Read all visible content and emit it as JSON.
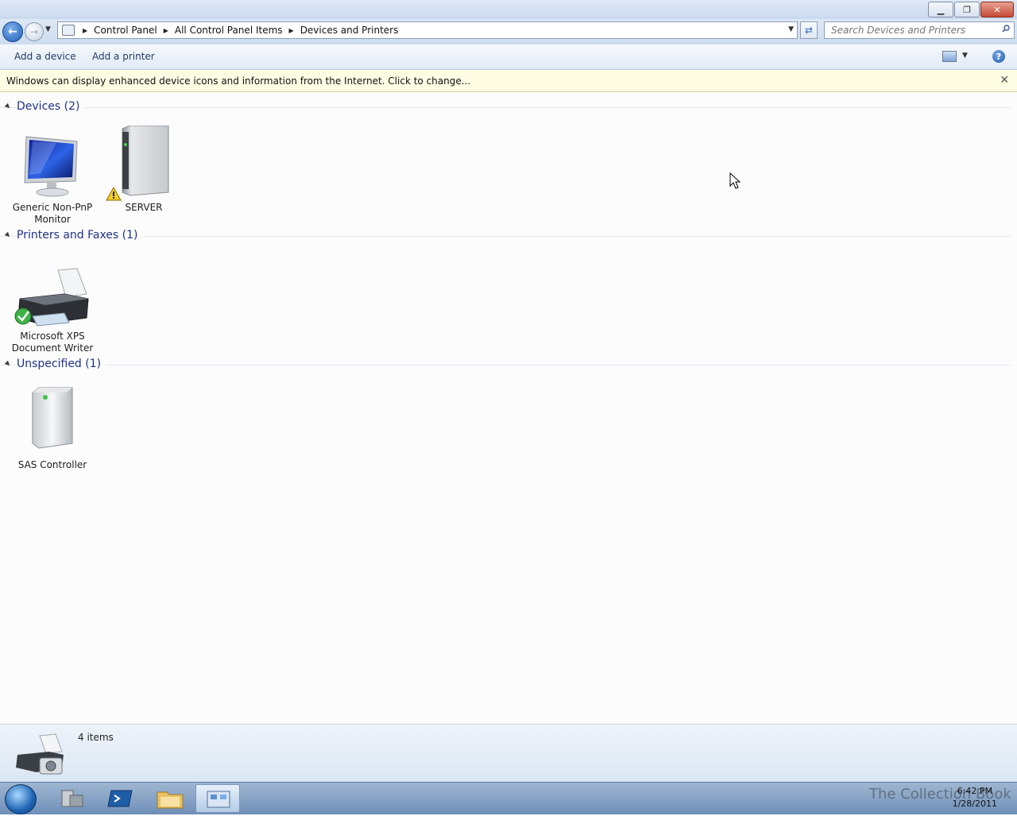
{
  "window": {
    "minimize": "▁",
    "maximize": "❐",
    "close": "✕"
  },
  "address": {
    "breadcrumbs": [
      "Control Panel",
      "All Control Panel Items",
      "Devices and Printers"
    ],
    "search_placeholder": "Search Devices and Printers"
  },
  "commands": {
    "add_device": "Add a device",
    "add_printer": "Add a printer",
    "help": "?"
  },
  "infobar": {
    "message": "Windows can display enhanced device icons and information from the Internet. Click to change..."
  },
  "groups": {
    "devices": {
      "title": "Devices (2)",
      "items": [
        {
          "label_line1": "Generic Non-PnP",
          "label_line2": "Monitor",
          "icon": "monitor-icon"
        },
        {
          "label_line1": "SERVER",
          "icon": "server-icon",
          "badge": "warning-icon"
        }
      ]
    },
    "printers": {
      "title": "Printers and Faxes (1)",
      "items": [
        {
          "label_line1": "Microsoft XPS",
          "label_line2": "Document Writer",
          "icon": "printer-icon",
          "badge": "default-check-icon"
        }
      ]
    },
    "unspecified": {
      "title": "Unspecified (1)",
      "items": [
        {
          "label_line1": "SAS Controller",
          "icon": "controller-icon"
        }
      ]
    }
  },
  "status": {
    "count": "4 items"
  },
  "taskbar": {
    "watermark": "The Collection Book",
    "time": "6:42 PM",
    "date": "1/28/2011"
  },
  "colors": {
    "accent": "#1e3287",
    "infobar": "#fefde3",
    "taskbar": "#7f9dc4"
  }
}
